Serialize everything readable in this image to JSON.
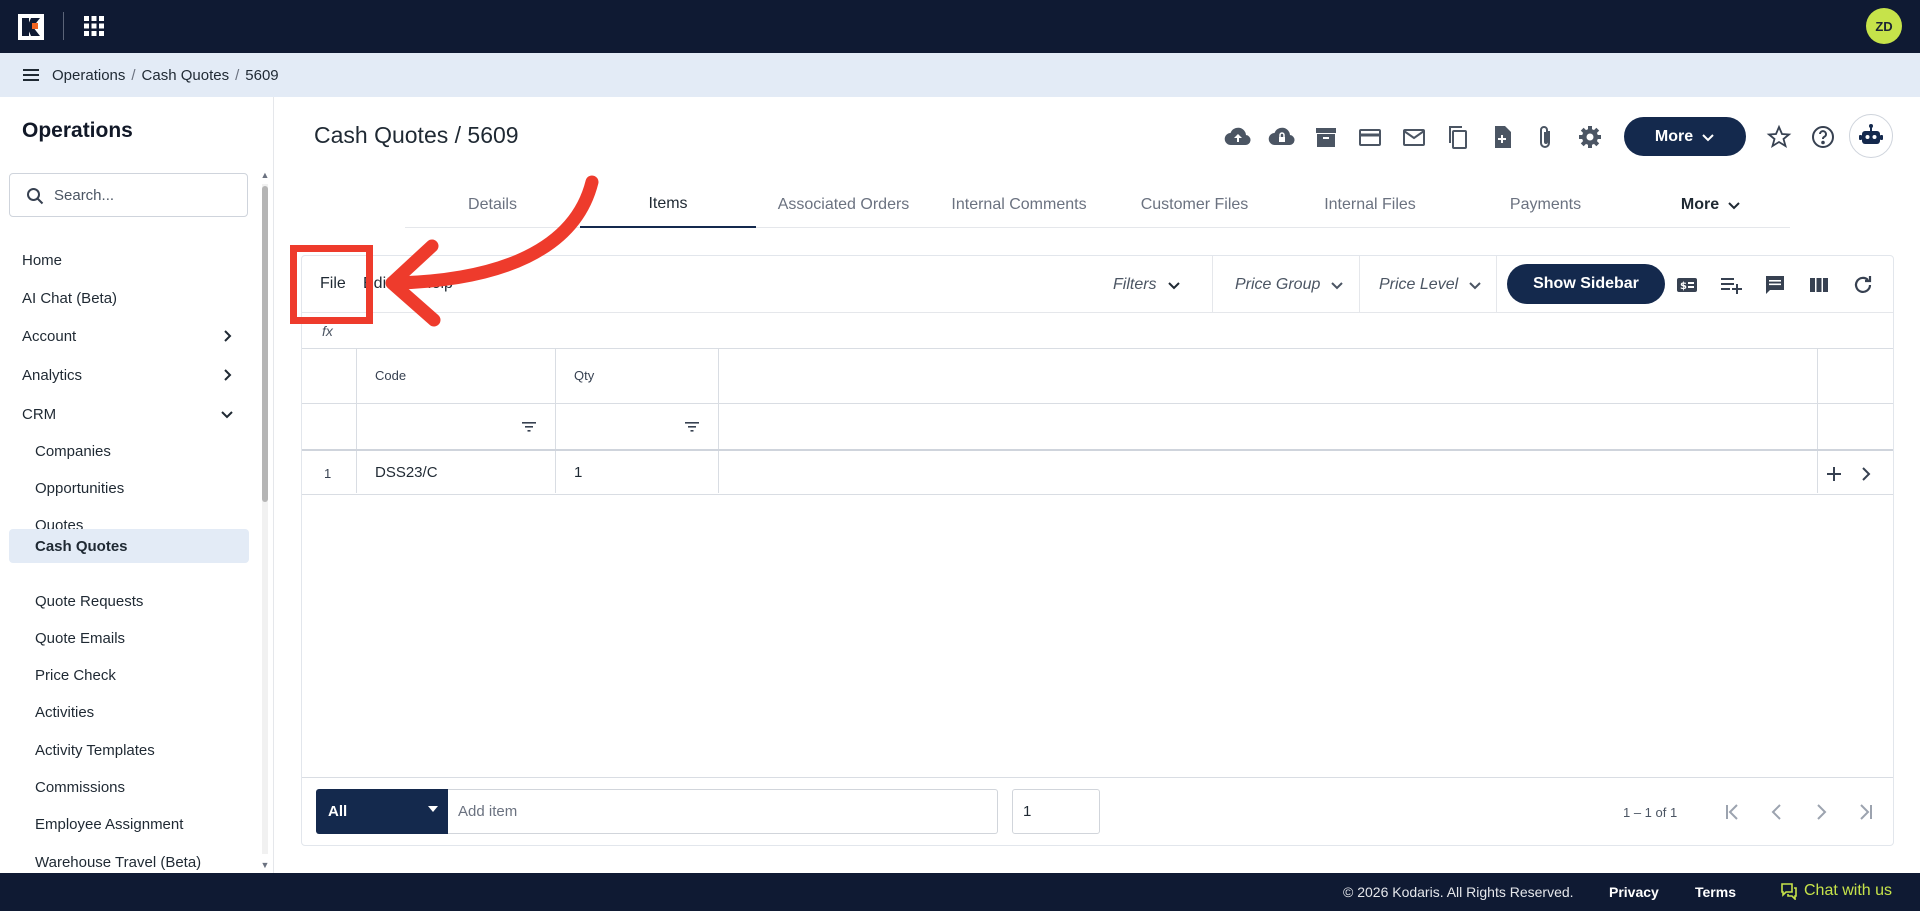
{
  "app": {
    "avatar_initials": "ZD",
    "brand_color": "#0f1a33",
    "accent": "#14294d",
    "avatar_color": "#c6e34a"
  },
  "breadcrumb": [
    "Operations",
    "Cash Quotes",
    "5609"
  ],
  "sidebar": {
    "title": "Operations",
    "search_placeholder": "Search...",
    "items": [
      {
        "label": "Home",
        "level": "top"
      },
      {
        "label": "AI Chat (Beta)",
        "level": "top"
      },
      {
        "label": "Account",
        "level": "top",
        "chevron": "right"
      },
      {
        "label": "Analytics",
        "level": "top",
        "chevron": "right"
      },
      {
        "label": "CRM",
        "level": "top",
        "chevron": "down"
      },
      {
        "label": "Companies",
        "level": "sub"
      },
      {
        "label": "Opportunities",
        "level": "sub"
      },
      {
        "label": "Quotes",
        "level": "sub"
      },
      {
        "label": "Cash Quotes",
        "level": "sub",
        "active": true
      },
      {
        "label": "Quote Requests",
        "level": "sub"
      },
      {
        "label": "Quote Emails",
        "level": "sub"
      },
      {
        "label": "Price Check",
        "level": "sub"
      },
      {
        "label": "Activities",
        "level": "sub"
      },
      {
        "label": "Activity Templates",
        "level": "sub"
      },
      {
        "label": "Commissions",
        "level": "sub"
      },
      {
        "label": "Employee Assignment",
        "level": "sub"
      },
      {
        "label": "Warehouse Travel (Beta)",
        "level": "sub"
      }
    ]
  },
  "header": {
    "title": "Cash Quotes / 5609",
    "more_label": "More",
    "icons": [
      "cloud-upload-icon",
      "cloud-lock-icon",
      "archive-icon",
      "credit-card-icon",
      "mail-icon",
      "copy-icon",
      "new-document-icon",
      "attachment-icon",
      "settings-gear-icon",
      "star-icon",
      "help-icon",
      "robot-icon"
    ]
  },
  "tabs": {
    "items": [
      "Details",
      "Items",
      "Associated Orders",
      "Internal Comments",
      "Customer Files",
      "Internal Files",
      "Payments"
    ],
    "active": "Items",
    "more_label": "More"
  },
  "toolbar": {
    "menu": [
      "File",
      "Edit",
      "Help"
    ],
    "filters_label": "Filters",
    "price_group_label": "Price Group",
    "price_level_label": "Price Level",
    "show_sidebar_label": "Show Sidebar",
    "formula_label": "fx"
  },
  "grid": {
    "columns": [
      "Code",
      "Qty"
    ],
    "rows": [
      {
        "num": "1",
        "code": "DSS23/C",
        "qty": "1"
      }
    ]
  },
  "add_item": {
    "select_value": "All",
    "placeholder": "Add item",
    "qty_value": "1",
    "pager_text": "1 – 1 of 1"
  },
  "footer": {
    "copyright": "© 2026 Kodaris. All Rights Reserved.",
    "privacy": "Privacy",
    "terms": "Terms",
    "chat": "Chat with us"
  },
  "annotation": {
    "color": "#ee3b2c"
  }
}
